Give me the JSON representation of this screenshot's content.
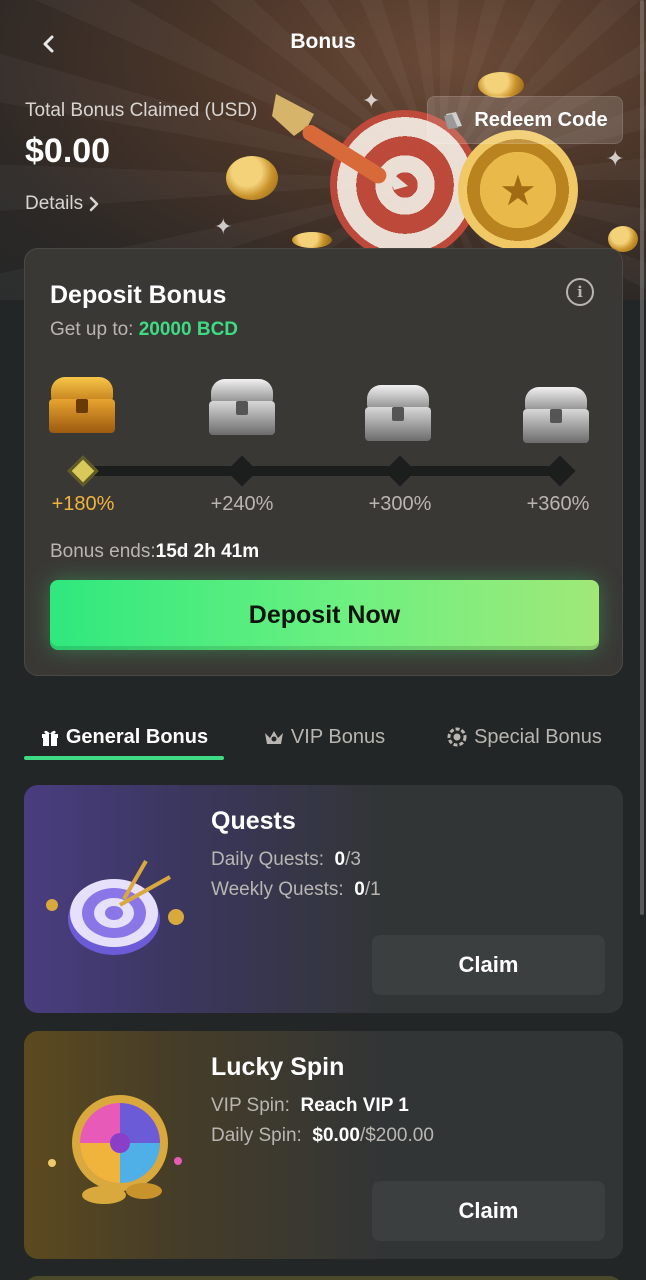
{
  "header": {
    "title": "Bonus",
    "back_icon": "chevron-left-icon"
  },
  "summary": {
    "total_label": "Total Bonus Claimed (USD)",
    "total_value": "$0.00",
    "details_label": "Details",
    "redeem_label": "Redeem Code"
  },
  "deposit_bonus": {
    "title": "Deposit Bonus",
    "get_up_to_label": "Get up to:",
    "get_up_to_amount": "20000 BCD",
    "tiers": [
      "+180%",
      "+240%",
      "+300%",
      "+360%"
    ],
    "active_tier": 0,
    "ends_label": "Bonus ends:",
    "ends_value": "15d 2h 41m",
    "deposit_button": "Deposit Now"
  },
  "tabs": [
    {
      "label": "General Bonus",
      "icon": "gift-icon",
      "active": true
    },
    {
      "label": "VIP Bonus",
      "icon": "crown-icon",
      "active": false
    },
    {
      "label": "Special Bonus",
      "icon": "gear-badge-icon",
      "active": false
    }
  ],
  "cards": {
    "quests": {
      "title": "Quests",
      "daily_label": "Daily Quests:",
      "daily_done": "0",
      "daily_total": "/3",
      "weekly_label": "Weekly Quests:",
      "weekly_done": "0",
      "weekly_total": "/1",
      "claim_label": "Claim"
    },
    "lucky_spin": {
      "title": "Lucky Spin",
      "vip_label": "VIP Spin:",
      "vip_value": "Reach VIP 1",
      "daily_label": "Daily Spin:",
      "daily_value": "$0.00",
      "daily_total": "/$200.00",
      "claim_label": "Claim"
    }
  },
  "colors": {
    "accent_green": "#3ddc84",
    "tier_active": "#f0b43c",
    "background": "#232626"
  }
}
